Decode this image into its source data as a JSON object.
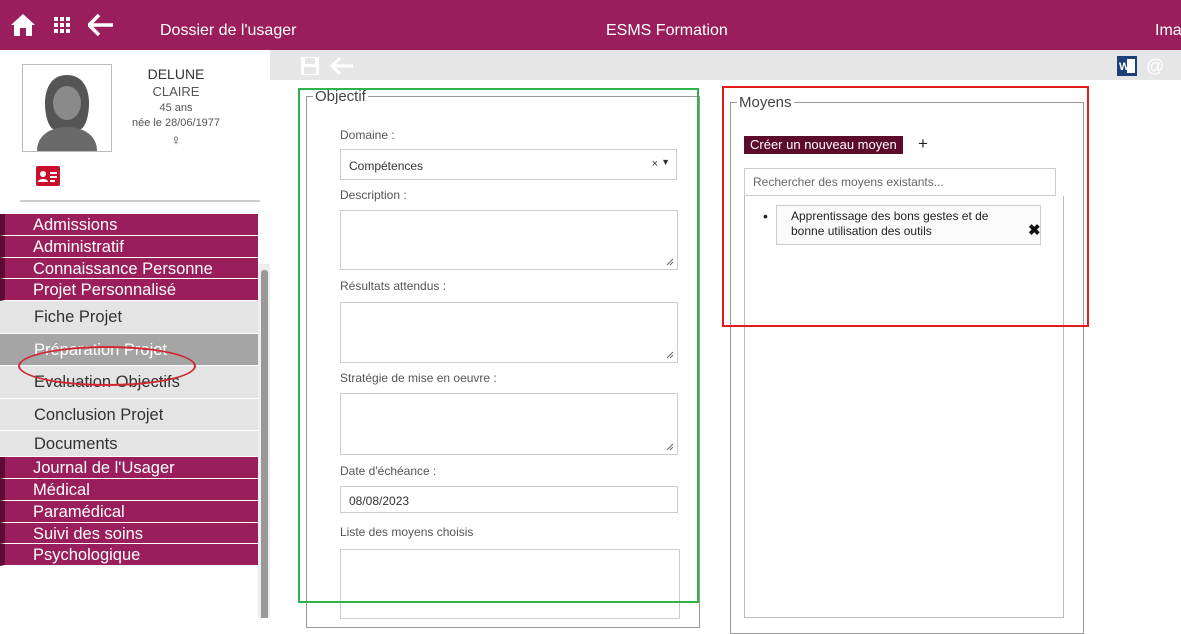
{
  "topbar": {
    "breadcrumb": "Dossier de l'usager",
    "app_title": "ESMS Formation",
    "right_text": "Imag",
    "icons": [
      "home-icon",
      "apps-grid-icon",
      "back-arrow-icon"
    ]
  },
  "patient": {
    "lastname": "DELUNE",
    "firstname": "CLAIRE",
    "age": "45 ans",
    "born": "née le 28/06/1977",
    "sex_symbol": "♀"
  },
  "menu": [
    {
      "label": "Admissions",
      "style": "dark"
    },
    {
      "label": "Administratif",
      "style": "dark"
    },
    {
      "label": "Connaissance Personne",
      "style": "dark"
    },
    {
      "label": "Projet Personnalisé",
      "style": "dark"
    },
    {
      "label": "Fiche Projet",
      "style": "light"
    },
    {
      "label": "Préparation Projet",
      "style": "active"
    },
    {
      "label": "Evaluation Objectifs",
      "style": "light"
    },
    {
      "label": "Conclusion Projet",
      "style": "light"
    },
    {
      "label": "Documents",
      "style": "light"
    },
    {
      "label": "Journal de l'Usager",
      "style": "dark"
    },
    {
      "label": "Médical",
      "style": "dark"
    },
    {
      "label": "Paramédical",
      "style": "dark"
    },
    {
      "label": "Suivi des soins",
      "style": "dark"
    },
    {
      "label": "Psychologique",
      "style": "dark"
    }
  ],
  "objectif": {
    "legend": "Objectif",
    "domaine_label": "Domaine :",
    "domaine_value": "Compétences",
    "description_label": "Description :",
    "resultats_label": "Résultats attendus :",
    "strategie_label": "Stratégie de mise en oeuvre :",
    "date_label": "Date d'échéance :",
    "date_value": "08/08/2023",
    "liste_label": "Liste des moyens choisis"
  },
  "moyens": {
    "legend": "Moyens",
    "new_button": "Créer un nouveau moyen",
    "plus": "+",
    "search_placeholder": "Rechercher des moyens existants...",
    "items": [
      {
        "line1": "Apprentissage des bons gestes et de",
        "line2": "bonne utilisation des outils"
      }
    ]
  },
  "colors": {
    "brand": "#9a1e5c",
    "brand_dark": "#5c0b2a",
    "highlight_green": "#2db34a",
    "highlight_red": "#e41b1b"
  }
}
